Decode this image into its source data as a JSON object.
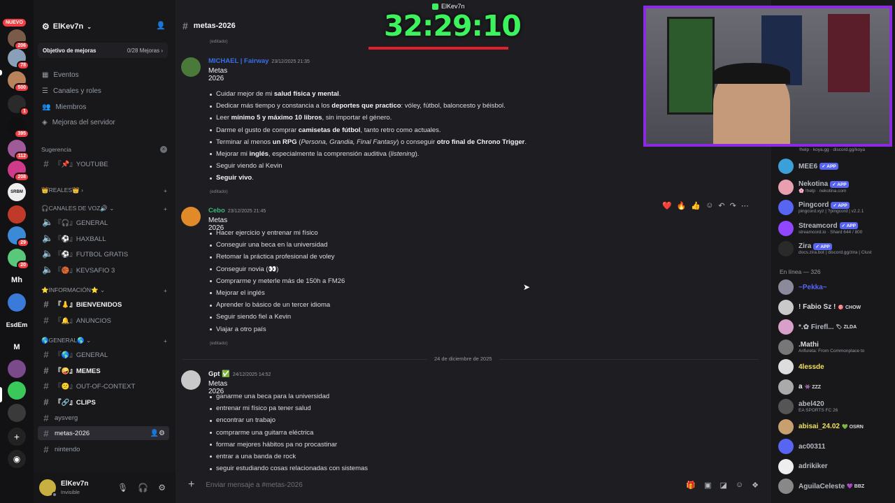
{
  "rail": {
    "nuevo": "NUEVO",
    "badges": [
      "206",
      "78",
      "500",
      "1",
      "395",
      "112",
      "208",
      "",
      "",
      "",
      "29",
      "20"
    ],
    "mh": "Mh",
    "esd": "EsdEm",
    "m": "M",
    "add_icon": "plus-icon",
    "discover_icon": "compass-icon"
  },
  "server": {
    "name": "ElKev7n",
    "boost_label": "Objetivo de mejoras",
    "boost_count": "0/28 Mejoras",
    "nav": [
      "Eventos",
      "Canales y roles",
      "Miembros",
      "Mejoras del servidor"
    ],
    "suggestion": "Sugerencia",
    "suggestion_channel": "『📌』YOUTUBE",
    "cat_reales": "👑REALES👑",
    "cat_voice": "🎧CANALES DE VOZ🔊",
    "voice": [
      "『🎧』GENERAL",
      "『⚽』HAXBALL",
      "『⚽』FUTBOL GRATIS",
      "『🏀』KEVSAFIO 3"
    ],
    "cat_info": "⭐INFORMACIÓN⭐",
    "info": [
      "『👃』BIENVENIDOS",
      "『🔔』ANUNCIOS"
    ],
    "cat_general": "🌎GENERAL🌎",
    "general": [
      "『🌎』GENERAL",
      "『🤪』MEMES",
      "『😕』OUT-OF-CONTEXT",
      "『🔗』CLIPS",
      "aysverg",
      "metas-2026",
      "nintendo"
    ]
  },
  "user": {
    "name": "ElKev7n",
    "status": "Invisible"
  },
  "channel": {
    "name": "metas-2026",
    "input_placeholder": "Enviar mensaje a #metas-2026"
  },
  "messages": {
    "edited": "(editado)",
    "m1": {
      "author": "MICHAEL | Fairway",
      "time": "23/12/2025 21:35",
      "title": "Metas 2026",
      "items": [
        [
          [
            "Cuidar mejor de mi ",
            ""
          ],
          [
            "salud física y mental",
            "b"
          ],
          [
            ".",
            ""
          ]
        ],
        [
          [
            "Dedicar más tiempo y constancia a los ",
            ""
          ],
          [
            "deportes que practico",
            "b"
          ],
          [
            ": vóley, fútbol, baloncesto y béisbol.",
            ""
          ]
        ],
        [
          [
            "Leer ",
            ""
          ],
          [
            "mínimo 5 y máximo 10 libros",
            "b"
          ],
          [
            ", sin importar el género.",
            ""
          ]
        ],
        [
          [
            "Darme el gusto de comprar ",
            ""
          ],
          [
            "camisetas de fútbol",
            "b"
          ],
          [
            ", tanto retro como actuales.",
            ""
          ]
        ],
        [
          [
            "Terminar al menos ",
            ""
          ],
          [
            "un RPG",
            "b"
          ],
          [
            " (",
            ""
          ],
          [
            "Persona, Grandia, Final Fantasy",
            "i"
          ],
          [
            ") o conseguir ",
            ""
          ],
          [
            "otro final de Chrono Trigger",
            "b"
          ],
          [
            ".",
            ""
          ]
        ],
        [
          [
            "Mejorar mi ",
            ""
          ],
          [
            "inglés",
            "b"
          ],
          [
            ", especialmente la comprensión auditiva (",
            ""
          ],
          [
            "listening",
            "i"
          ],
          [
            ").",
            ""
          ]
        ],
        [
          [
            "Seguir viendo al Kevin",
            ""
          ]
        ],
        [
          [
            "Seguir vivo",
            "b"
          ],
          [
            ".",
            ""
          ]
        ]
      ]
    },
    "m2": {
      "author": "Cebo",
      "time": "23/12/2025 21:45",
      "title": "Metas 2026",
      "items": [
        "Hacer ejercicio y entrenar mi físico",
        "Conseguir una beca en la universidad",
        "Retomar la práctica profesional de voley",
        "Conseguir novia (👀)",
        "Comprarme y meterle más de 150h a FM26",
        "Mejorar el inglés",
        "Aprender lo básico de un tercer idioma",
        "Seguir siendo fiel a Kevin",
        "Viajar a otro país"
      ]
    },
    "date_sep": "24 de diciembre de 2025",
    "m3": {
      "author": "Gpt",
      "badge": "✅",
      "time": "24/12/2025 14:52",
      "title": "Metas 2026",
      "items": [
        "ganarme una beca para la universidad",
        "entrenar mi físico pa tener salud",
        "encontrar un trabajo",
        "comprarme una guitarra eléctrica",
        "formar mejores hábitos pa no procastinar",
        "entrar a una banda de rock",
        "seguir estudiando cosas relacionadas con sistemas"
      ]
    }
  },
  "reactions": [
    "❤️",
    "🔥",
    "👍"
  ],
  "members": {
    "top_status": "!help · koya.gg · discord.gg/koya",
    "bots": [
      {
        "name": "MEE6",
        "tag": "✓ APP",
        "status": "",
        "color": "#3ba0d8"
      },
      {
        "name": "Nekotina",
        "tag": "✓ APP",
        "status": "🌸 !help · nekotina.com",
        "color": "#e8a0b0"
      },
      {
        "name": "Pingcord",
        "tag": "✓ APP",
        "status": "pingcord.xyz | ?pingcord | v2.2.1",
        "color": "#5865f2"
      },
      {
        "name": "Streamcord",
        "tag": "✓ APP",
        "status": "streamcord.io · Shard 644 / 800",
        "color": "#9146ff"
      },
      {
        "name": "Zira",
        "tag": "✓ APP",
        "status": "docs.zira.bot | discord.gg/zira | Clust",
        "color": "#2a2a2a"
      }
    ],
    "online_label": "En línea — 326",
    "online": [
      {
        "name": "~Pekka~",
        "status": "",
        "color": "#8a8a9a",
        "ncolor": "#5865f2"
      },
      {
        "name": "! Fabio Sz !",
        "tag": "🎯 CHOW",
        "status": "",
        "color": "#c9c9c9",
        "ncolor": "#dbdee1"
      },
      {
        "name": "*.✿ Firefl...",
        "tag": "🏷 ZLDA",
        "status": "",
        "color": "#d8a0c8",
        "ncolor": "#b5bac1"
      },
      {
        "name": ".Mathi",
        "status": "Arifureta: From Commonplace to",
        "color": "#777",
        "ncolor": "#dbdee1"
      },
      {
        "name": "4lessde",
        "status": "",
        "color": "#ddd",
        "ncolor": "#f1e05a"
      },
      {
        "name": "a",
        "tag": "👾 ZZZ",
        "status": "",
        "color": "#aaa",
        "ncolor": "#f2f3f5"
      },
      {
        "name": "abel420",
        "status": "EA SPORTS FC 26",
        "color": "#555",
        "ncolor": "#b5bac1"
      },
      {
        "name": "abisai_24.02",
        "tag": "💚 OSRN",
        "status": "",
        "color": "#c8a070",
        "ncolor": "#f1e05a"
      },
      {
        "name": "ac00311",
        "status": "",
        "color": "#5865f2",
        "ncolor": "#b5bac1"
      },
      {
        "name": "adrikiker",
        "status": "",
        "color": "#eee",
        "ncolor": "#b5bac1"
      },
      {
        "name": "AguilaCeleste",
        "tag": "💜 BBZ",
        "status": "",
        "color": "#888",
        "ncolor": "#b5bac1"
      }
    ]
  },
  "stream": {
    "timer": "32:29:10",
    "streamer_name": "ElKev7n"
  }
}
